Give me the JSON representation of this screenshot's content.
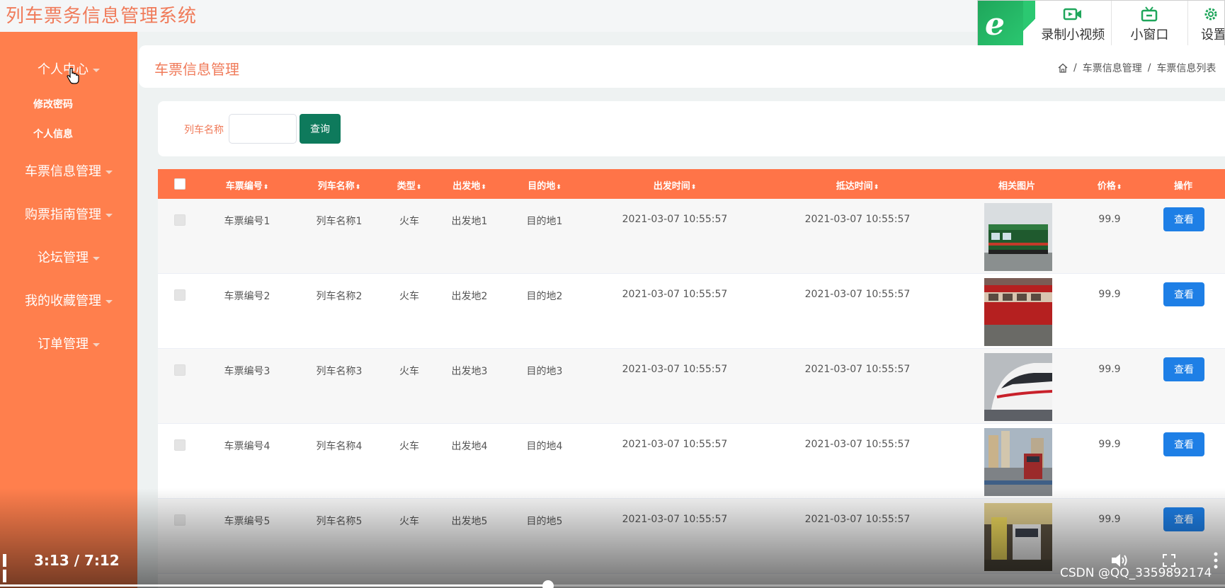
{
  "app": {
    "title": "列车票务信息管理系统"
  },
  "toolbar": {
    "items": [
      {
        "label": "录制小视频",
        "icon": "video-record-icon"
      },
      {
        "label": "小窗口",
        "icon": "tv-icon"
      },
      {
        "label": "设置",
        "icon": "gear-icon"
      }
    ]
  },
  "sidebar": {
    "personal_center": "个人中心",
    "sub_change_password": "修改密码",
    "sub_personal_info": "个人信息",
    "ticket_mgmt": "车票信息管理",
    "guide_mgmt": "购票指南管理",
    "forum_mgmt": "论坛管理",
    "favorites_mgmt": "我的收藏管理",
    "order_mgmt": "订单管理"
  },
  "header": {
    "title": "车票信息管理",
    "breadcrumb": [
      "车票信息管理",
      "车票信息列表"
    ]
  },
  "search": {
    "label": "列车名称",
    "input_value": "",
    "button": "查询"
  },
  "table": {
    "columns": [
      "车票编号",
      "列车名称",
      "类型",
      "出发地",
      "目的地",
      "出发时间",
      "抵达时间",
      "相关图片",
      "价格",
      "操作"
    ],
    "rows": [
      {
        "ticket_no": "车票编号1",
        "train_name": "列车名称1",
        "type": "火车",
        "from": "出发地1",
        "to": "目的地1",
        "depart": "2021-03-07 10:55:57",
        "arrive": "2021-03-07 10:55:57",
        "price": "99.9",
        "action": "查看"
      },
      {
        "ticket_no": "车票编号2",
        "train_name": "列车名称2",
        "type": "火车",
        "from": "出发地2",
        "to": "目的地2",
        "depart": "2021-03-07 10:55:57",
        "arrive": "2021-03-07 10:55:57",
        "price": "99.9",
        "action": "查看"
      },
      {
        "ticket_no": "车票编号3",
        "train_name": "列车名称3",
        "type": "火车",
        "from": "出发地3",
        "to": "目的地3",
        "depart": "2021-03-07 10:55:57",
        "arrive": "2021-03-07 10:55:57",
        "price": "99.9",
        "action": "查看"
      },
      {
        "ticket_no": "车票编号4",
        "train_name": "列车名称4",
        "type": "火车",
        "from": "出发地4",
        "to": "目的地4",
        "depart": "2021-03-07 10:55:57",
        "arrive": "2021-03-07 10:55:57",
        "price": "99.9",
        "action": "查看"
      },
      {
        "ticket_no": "车票编号5",
        "train_name": "列车名称5",
        "type": "火车",
        "from": "出发地5",
        "to": "目的地5",
        "depart": "2021-03-07 10:55:57",
        "arrive": "2021-03-07 10:55:57",
        "price": "99.9",
        "action": "查看"
      }
    ]
  },
  "video": {
    "time": "3:13 / 7:12",
    "progress": 0.447,
    "watermark": "CSDN @QQ_3359892174"
  },
  "colors": {
    "accent": "#ff7f4d",
    "header_bar": "#ff7448",
    "title_text": "#f07b5a",
    "search_button": "#0e7a5c",
    "view_button": "#1e7fe6"
  }
}
